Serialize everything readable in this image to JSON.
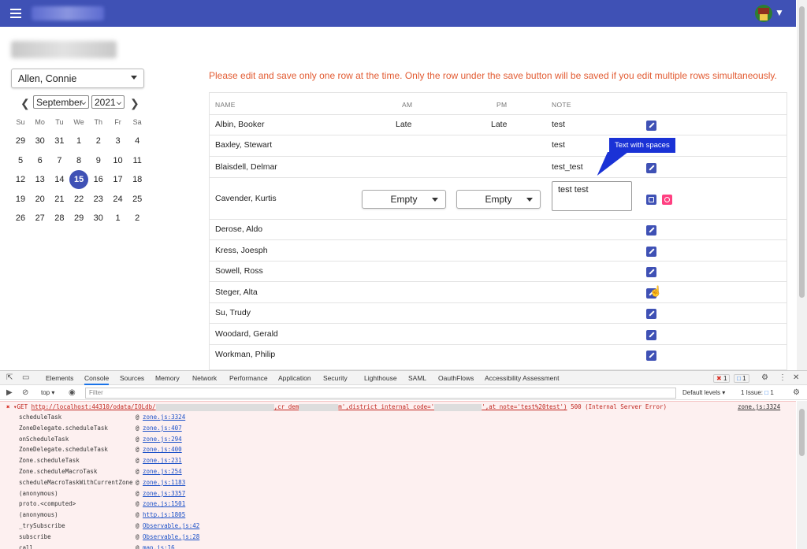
{
  "app": {
    "menu_icon": "hamburger-menu-icon",
    "avatar_icon": "user-avatar-icon"
  },
  "student_select": {
    "value": "Allen, Connie"
  },
  "calendar": {
    "month": "September",
    "year": "2021",
    "weekdays": [
      "Su",
      "Mo",
      "Tu",
      "We",
      "Th",
      "Fr",
      "Sa"
    ],
    "weeks": [
      [
        "29",
        "30",
        "31",
        "1",
        "2",
        "3",
        "4"
      ],
      [
        "5",
        "6",
        "7",
        "8",
        "9",
        "10",
        "11"
      ],
      [
        "12",
        "13",
        "14",
        "15",
        "16",
        "17",
        "18"
      ],
      [
        "19",
        "20",
        "21",
        "22",
        "23",
        "24",
        "25"
      ],
      [
        "26",
        "27",
        "28",
        "29",
        "30",
        "1",
        "2"
      ]
    ],
    "selected_day": "15",
    "prev_icon": "chevron-left-icon",
    "next_icon": "chevron-right-icon"
  },
  "warning": "Please edit and save only one row at the time. Only the row under the save button will be saved if you edit multiple rows simultaneously.",
  "table": {
    "headers": {
      "name": "NAME",
      "am": "AM",
      "pm": "PM",
      "note": "NOTE"
    },
    "rows": [
      {
        "name": "Albin, Booker",
        "am": "Late",
        "pm": "Late",
        "note": "test"
      },
      {
        "name": "Baxley, Stewart",
        "am": "",
        "pm": "",
        "note": "test"
      },
      {
        "name": "Blaisdell, Delmar",
        "am": "",
        "pm": "",
        "note": "test_test"
      },
      {
        "name": "Cavender, Kurtis",
        "am_select": "Empty",
        "pm_select": "Empty",
        "note_input": "test test",
        "editing": true
      },
      {
        "name": "Derose, Aldo",
        "am": "",
        "pm": "",
        "note": ""
      },
      {
        "name": "Kress, Joesph",
        "am": "",
        "pm": "",
        "note": ""
      },
      {
        "name": "Sowell, Ross",
        "am": "",
        "pm": "",
        "note": ""
      },
      {
        "name": "Steger, Alta",
        "am": "",
        "pm": "",
        "note": ""
      },
      {
        "name": "Su, Trudy",
        "am": "",
        "pm": "",
        "note": ""
      },
      {
        "name": "Woodard, Gerald",
        "am": "",
        "pm": "",
        "note": ""
      },
      {
        "name": "Workman, Philip",
        "am": "",
        "pm": "",
        "note": ""
      }
    ],
    "tooltip": "Text with spaces"
  },
  "devtools": {
    "tabs": [
      "Elements",
      "Console",
      "Sources",
      "Memory",
      "Network",
      "Performance",
      "Application",
      "Security",
      "Lighthouse",
      "SAML",
      "OauthFlows",
      "Accessibility Assessment"
    ],
    "active_tab": "Console",
    "error_count": "1",
    "message_count": "1",
    "context": "top",
    "filter_placeholder": "Filter",
    "levels": "Default levels",
    "issues": "1 Issue:",
    "issues_count": "1",
    "error": {
      "method": "GET",
      "url_start": "http://localhost:44310/odata/IOLdb/",
      "url_mid1": ",cr_dem",
      "url_mid2": "m',district_internal_code='",
      "url_end": "',at_note='test%20test')",
      "status": "500 (Internal Server Error)",
      "source": "zone.js:3324"
    },
    "trace": [
      {
        "fn": "scheduleTask",
        "loc": "zone.js:3324"
      },
      {
        "fn": "ZoneDelegate.scheduleTask",
        "loc": "zone.js:407"
      },
      {
        "fn": "onScheduleTask",
        "loc": "zone.js:294"
      },
      {
        "fn": "ZoneDelegate.scheduleTask",
        "loc": "zone.js:400"
      },
      {
        "fn": "Zone.scheduleTask",
        "loc": "zone.js:231"
      },
      {
        "fn": "Zone.scheduleMacroTask",
        "loc": "zone.js:254"
      },
      {
        "fn": "scheduleMacroTaskWithCurrentZone",
        "loc": "zone.js:1183"
      },
      {
        "fn": "(anonymous)",
        "loc": "zone.js:3357"
      },
      {
        "fn": "proto.<computed>",
        "loc": "zone.js:1501"
      },
      {
        "fn": "(anonymous)",
        "loc": "http.js:1805"
      },
      {
        "fn": "_trySubscribe",
        "loc": "Observable.js:42"
      },
      {
        "fn": "subscribe",
        "loc": "Observable.js:28"
      },
      {
        "fn": "call",
        "loc": "map.js:16"
      }
    ]
  }
}
